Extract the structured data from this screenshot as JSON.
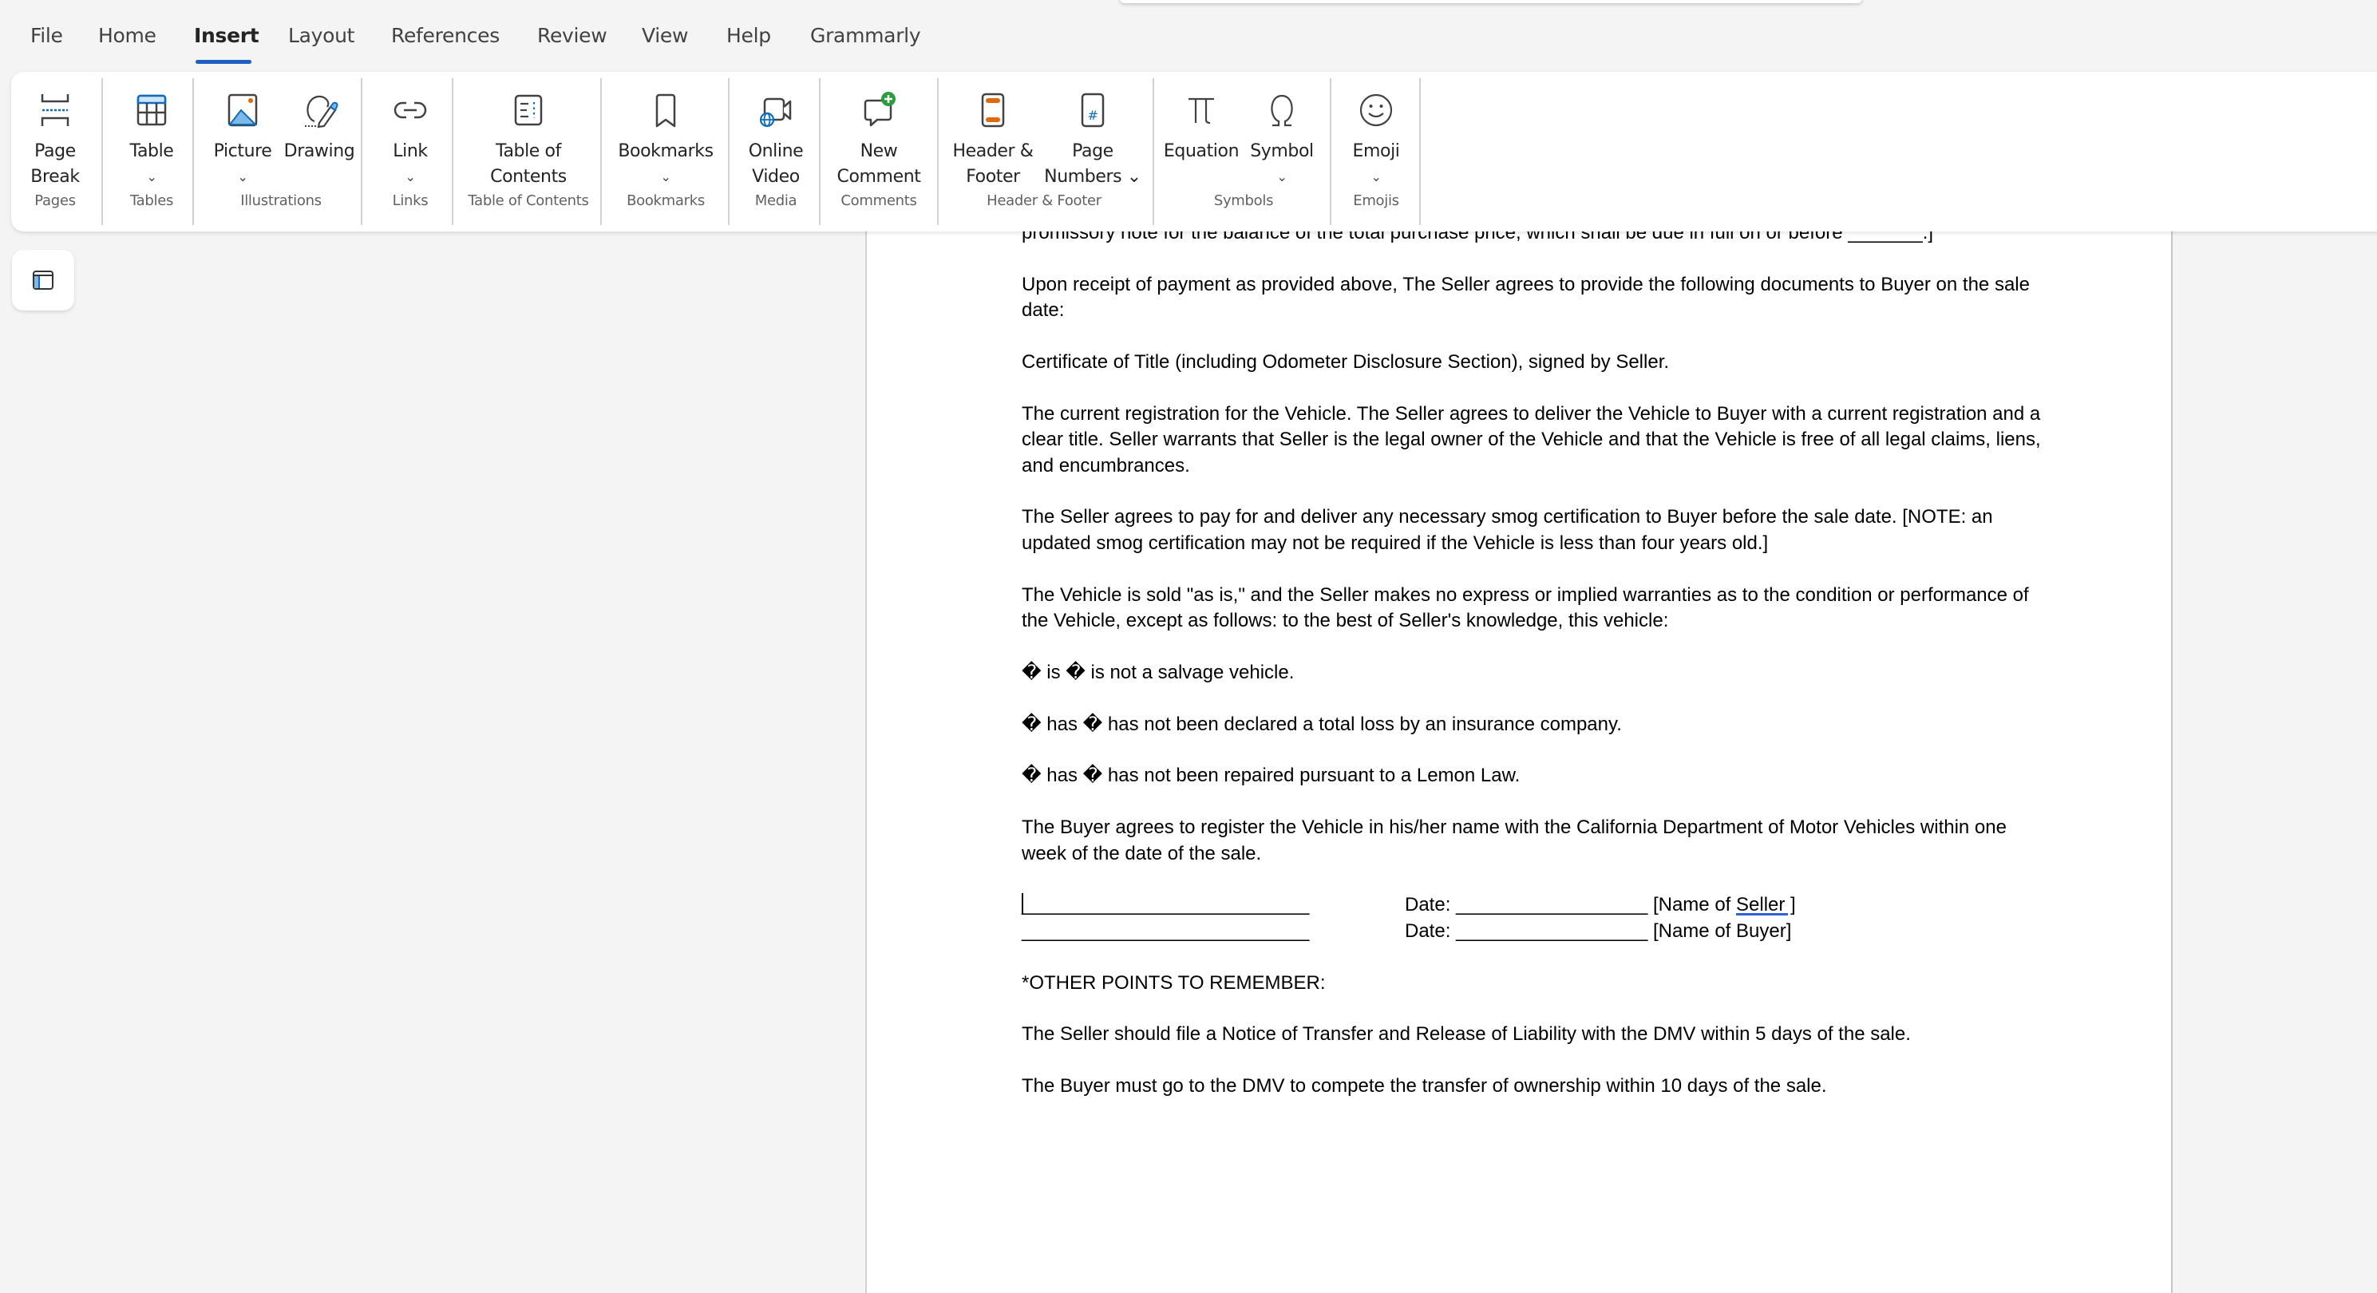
{
  "tabs": [
    {
      "label": "File",
      "active": false
    },
    {
      "label": "Home",
      "active": false
    },
    {
      "label": "Insert",
      "active": true
    },
    {
      "label": "Layout",
      "active": false
    },
    {
      "label": "References",
      "active": false
    },
    {
      "label": "Review",
      "active": false
    },
    {
      "label": "View",
      "active": false
    },
    {
      "label": "Help",
      "active": false
    },
    {
      "label": "Grammarly",
      "active": false
    }
  ],
  "ribbon": {
    "groups": [
      {
        "label": "Pages",
        "buttons": [
          {
            "line1": "Page",
            "line2": "Break",
            "icon": "page-break-icon"
          }
        ]
      },
      {
        "label": "Tables",
        "buttons": [
          {
            "line1": "Table",
            "dropdown": "⌄",
            "icon": "table-icon"
          }
        ]
      },
      {
        "label": "Illustrations",
        "buttons": [
          {
            "line1": "Picture",
            "dropdown": "⌄",
            "icon": "picture-icon"
          },
          {
            "line1": "Drawing",
            "icon": "drawing-icon"
          }
        ]
      },
      {
        "label": "Links",
        "buttons": [
          {
            "line1": "Link",
            "dropdown": "⌄",
            "icon": "link-icon"
          }
        ]
      },
      {
        "label": "Table of Contents",
        "buttons": [
          {
            "line1": "Table of",
            "line2": "Contents",
            "icon": "table-of-contents-icon"
          }
        ]
      },
      {
        "label": "Bookmarks",
        "buttons": [
          {
            "line1": "Bookmarks",
            "dropdown": "⌄",
            "icon": "bookmark-icon"
          }
        ]
      },
      {
        "label": "Media",
        "buttons": [
          {
            "line1": "Online",
            "line2": "Video",
            "icon": "online-video-icon"
          }
        ]
      },
      {
        "label": "Comments",
        "buttons": [
          {
            "line1": "New",
            "line2": "Comment",
            "icon": "new-comment-icon"
          }
        ]
      },
      {
        "label": "Header & Footer",
        "buttons": [
          {
            "line1": "Header &",
            "line2": "Footer",
            "icon": "header-footer-icon"
          },
          {
            "line1": "Page",
            "line2": "Numbers ⌄",
            "icon": "page-numbers-icon"
          }
        ]
      },
      {
        "label": "Symbols",
        "buttons": [
          {
            "line1": "Equation",
            "icon": "equation-icon"
          },
          {
            "line1": "Symbol",
            "dropdown": "⌄",
            "icon": "symbol-icon"
          }
        ]
      },
      {
        "label": "Emojis",
        "buttons": [
          {
            "line1": "Emoji",
            "dropdown": "⌄",
            "icon": "emoji-icon"
          }
        ]
      }
    ]
  },
  "document": {
    "paragraphs": [
      "promissory note for the balance of the total purchase price, which shall be due in full on or before _______.]",
      "Upon receipt of payment as provided above, The Seller agrees to provide the following documents to Buyer on the sale date:",
      "Certificate of Title (including Odometer Disclosure Section), signed by Seller.",
      "The current registration for the Vehicle. The Seller agrees to deliver the Vehicle to Buyer with a current registration and a clear title. Seller warrants that Seller is the legal owner of the Vehicle and that the Vehicle is free of all legal claims, liens, and encumbrances.",
      "The Seller agrees to pay for and deliver any necessary smog certification to Buyer before the sale date. [NOTE: an updated smog certification may not be required if the Vehicle is less than four years old.]",
      "The Vehicle is sold \"as is,\" and the Seller makes no express or implied warranties as to the condition or performance of the Vehicle, except as follows: to the best of Seller's knowledge, this vehicle:",
      "� is � is not a salvage vehicle.",
      "� has � has not been declared a total loss by an insurance company.",
      "� has � has not been repaired pursuant to a Lemon Law.",
      "The Buyer agrees to register the Vehicle in his/her name with the California Department of Motor Vehicles within one week of the date of the sale."
    ],
    "signature": {
      "line": "___________________________",
      "seller_date": "Date: __________________ [Name of ",
      "seller_word": "Seller ]",
      "buyer_date": "Date: __________________ [Name of Buyer]"
    },
    "closing": [
      "*OTHER POINTS TO REMEMBER:",
      "The Seller should file a Notice of Transfer and Release of Liability with the DMV within 5 days of the sale.",
      "The Buyer must go to the DMV to compete the transfer of ownership within 10 days of the sale."
    ]
  },
  "colors": {
    "accent": "#1e5fc6",
    "orange": "#e0690b",
    "green": "#2a9d3e",
    "icon_blue": "#0f6cbd"
  }
}
